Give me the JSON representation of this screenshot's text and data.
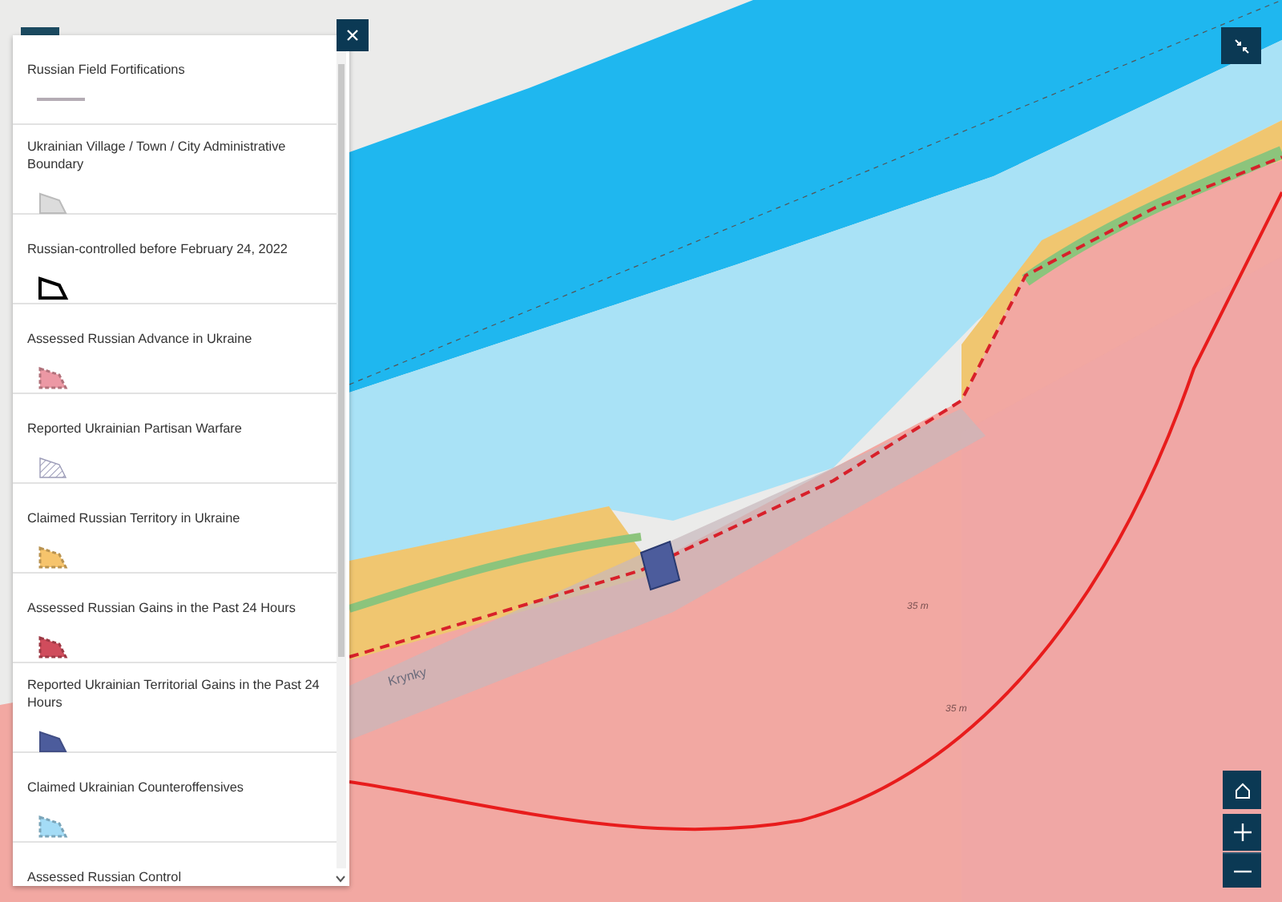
{
  "legend": {
    "items": [
      {
        "label": "Russian Field Fortifications",
        "kind": "line",
        "color": "#b4acb4"
      },
      {
        "label": "Ukrainian Village / Town / City Administrative Boundary",
        "kind": "solid",
        "color": "#dcdcdc"
      },
      {
        "label": "Russian-controlled before February 24, 2022",
        "kind": "outline",
        "color": "#000000"
      },
      {
        "label": "Assessed Russian Advance in Ukraine",
        "kind": "dashed",
        "color": "#ec98a4"
      },
      {
        "label": "Reported Ukrainian Partisan Warfare",
        "kind": "hatched",
        "color": "#9c9cb8"
      },
      {
        "label": "Claimed Russian Territory in Ukraine",
        "kind": "dashed",
        "color": "#f6c46c"
      },
      {
        "label": "Assessed Russian Gains in the Past 24 Hours",
        "kind": "dashed",
        "color": "#d04c5c"
      },
      {
        "label": "Reported Ukrainian Territorial Gains in the Past 24 Hours",
        "kind": "solid",
        "color": "#4c5c9c"
      },
      {
        "label": "Claimed Ukrainian Counteroffensives",
        "kind": "dashed",
        "color": "#a4dcf6"
      },
      {
        "label": "Assessed Russian Control",
        "kind": "none"
      }
    ]
  },
  "map": {
    "labels": [
      {
        "text": "Krynky",
        "kind": "place"
      },
      {
        "text": "35 m",
        "kind": "spot"
      },
      {
        "text": "35 m",
        "kind": "spot"
      }
    ]
  }
}
